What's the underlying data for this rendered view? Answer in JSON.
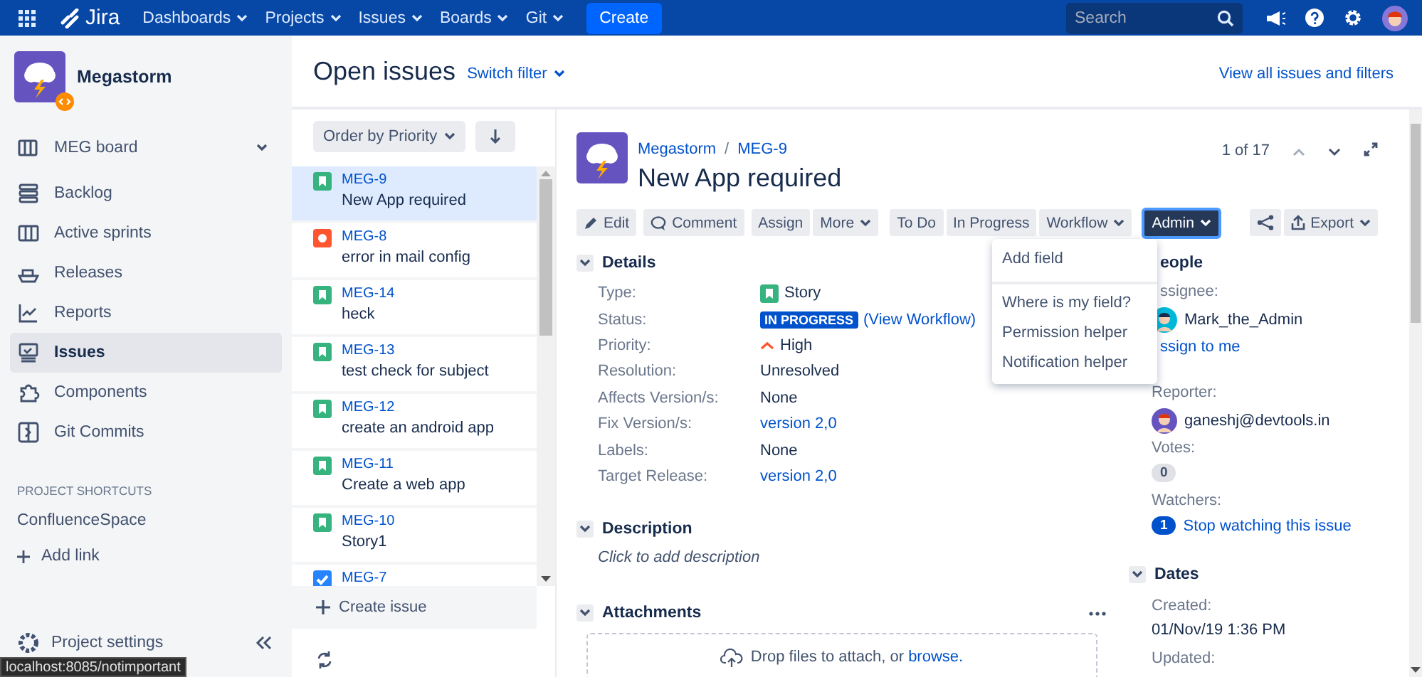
{
  "topbar": {
    "logo": "Jira",
    "menus": [
      "Dashboards",
      "Projects",
      "Issues",
      "Boards",
      "Git"
    ],
    "create": "Create",
    "search": {
      "placeholder": "Search"
    }
  },
  "sidebar": {
    "project": "Megastorm",
    "board": "MEG board",
    "items": [
      {
        "label": "Backlog",
        "selected": false
      },
      {
        "label": "Active sprints",
        "selected": false
      },
      {
        "label": "Releases",
        "selected": false
      },
      {
        "label": "Reports",
        "selected": false
      },
      {
        "label": "Issues",
        "selected": true
      },
      {
        "label": "Components",
        "selected": false
      },
      {
        "label": "Git Commits",
        "selected": false
      }
    ],
    "shortcuts_heading": "PROJECT SHORTCUTS",
    "shortcuts": [
      "ConfluenceSpace"
    ],
    "add_link": "Add link",
    "settings": "Project settings"
  },
  "page": {
    "title": "Open issues",
    "switch_filter": "Switch filter",
    "view_all": "View all issues and filters"
  },
  "issue_list": {
    "order": "Order by Priority",
    "issues": [
      {
        "key": "MEG-9",
        "summary": "New App required",
        "kind": "story",
        "selected": true
      },
      {
        "key": "MEG-8",
        "summary": "error in mail config",
        "kind": "bug",
        "selected": false
      },
      {
        "key": "MEG-14",
        "summary": "heck",
        "kind": "story",
        "selected": false
      },
      {
        "key": "MEG-13",
        "summary": "test check for subject",
        "kind": "story",
        "selected": false
      },
      {
        "key": "MEG-12",
        "summary": "create an android app",
        "kind": "story",
        "selected": false
      },
      {
        "key": "MEG-11",
        "summary": "Create a web app",
        "kind": "story",
        "selected": false
      },
      {
        "key": "MEG-10",
        "summary": "Story1",
        "kind": "story",
        "selected": false
      },
      {
        "key": "MEG-7",
        "kind": "task",
        "selected": false
      }
    ],
    "create_issue": "Create issue"
  },
  "issue": {
    "breadcrumb": [
      "Megastorm",
      "/",
      "MEG-9"
    ],
    "title": "New App required",
    "pager": "1 of 17",
    "action_groups": [
      [
        {
          "label": "Edit",
          "kind": "edit"
        }
      ],
      [
        {
          "label": "Comment",
          "kind": "comment"
        }
      ],
      [
        {
          "label": "Assign",
          "kind": "plain"
        },
        {
          "label": "More",
          "kind": "dropdown",
          "expanded": false
        }
      ],
      [
        {
          "label": "To Do",
          "kind": "plain"
        },
        {
          "label": "In Progress",
          "kind": "plain"
        },
        {
          "label": "Workflow",
          "kind": "dropdown",
          "expanded": false
        }
      ],
      [
        {
          "label": "Admin",
          "kind": "dropdown",
          "expanded": true
        }
      ]
    ],
    "extra_actions": [
      {
        "kind": "share"
      },
      {
        "label": "Export",
        "kind": "export",
        "expanded": false
      }
    ],
    "details_heading": "Details",
    "fields": [
      {
        "label": "Type:",
        "value": "Story",
        "kind": "story"
      },
      {
        "label": "Status:",
        "value": "IN PROGRESS",
        "link": "(View Workflow)",
        "kind": "status"
      },
      {
        "label": "Priority:",
        "value": "High",
        "kind": "priority"
      },
      {
        "label": "Resolution:",
        "value": "Unresolved",
        "kind": "text"
      },
      {
        "label": "Affects Version/s:",
        "value": "None",
        "kind": "text"
      },
      {
        "label": "Fix Version/s:",
        "value": "version 2,0",
        "kind": "link"
      },
      {
        "label": "Labels:",
        "value": "None",
        "kind": "text"
      },
      {
        "label": "Target Release:",
        "value": "version 2,0",
        "kind": "link"
      }
    ],
    "description_heading": "Description",
    "description_placeholder": "Click to add description",
    "attachments_heading": "Attachments",
    "drop_text": "Drop files to attach, or",
    "browse": "browse."
  },
  "admin_menu": {
    "groups": [
      [
        "Add field"
      ],
      [
        "Where is my field?",
        "Permission helper",
        "Notification helper"
      ]
    ]
  },
  "people": {
    "heading": "eople",
    "assignee_label": "ssignee:",
    "assignee": "Mark_the_Admin",
    "assign_to_me": "ssign to me",
    "reporter_label": "Reporter:",
    "reporter": "ganeshj@devtools.in",
    "votes_label": "Votes:",
    "votes": "0",
    "watchers_label": "Watchers:",
    "watchers": "1",
    "stop_watching": "Stop watching this issue"
  },
  "dates": {
    "heading": "Dates",
    "created_label": "Created:",
    "created": "01/Nov/19 1:36 PM",
    "updated_label": "Updated:"
  },
  "status_tooltip": "localhost:8085/notimportant"
}
